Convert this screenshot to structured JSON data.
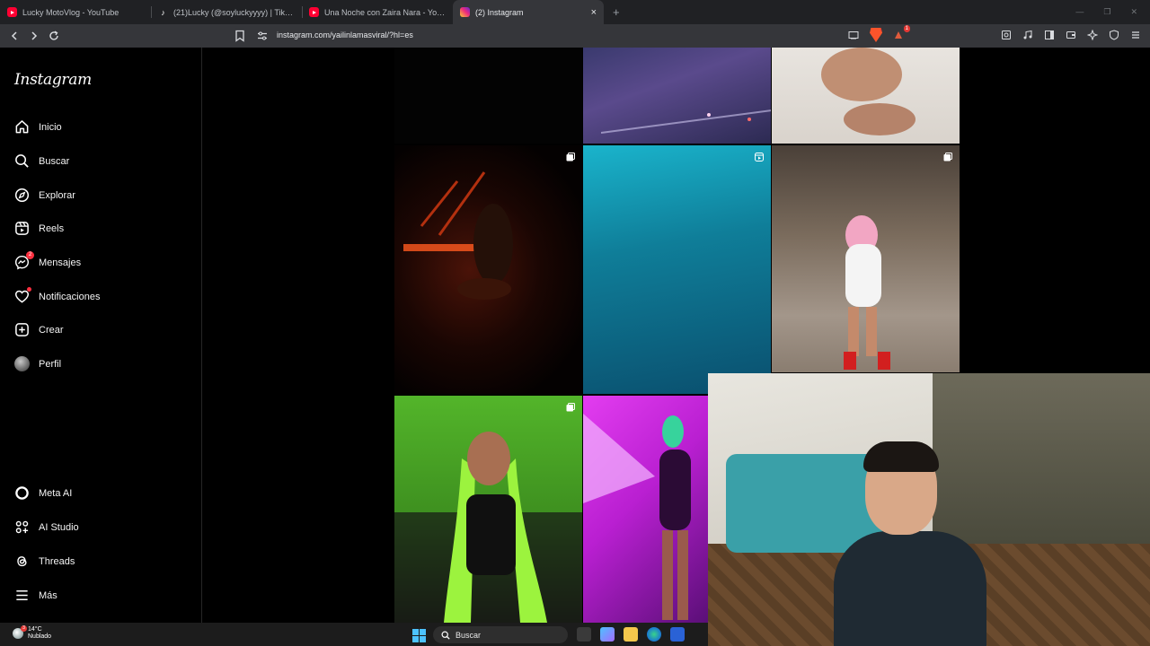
{
  "browser": {
    "tabs": [
      {
        "title": "Lucky MotoVlog - YouTube",
        "icon": "youtube-icon",
        "active": false
      },
      {
        "title": "(21)Lucky (@soyluckyyyy) | TikTok",
        "icon": "tiktok-icon",
        "active": false
      },
      {
        "title": "Una Noche con Zaira Nara - YouTube",
        "icon": "youtube-icon",
        "active": false
      },
      {
        "title": "(2) Instagram",
        "icon": "instagram-icon",
        "active": true
      }
    ],
    "new_tab_symbol": "+",
    "close_symbol": "×",
    "window_controls": [
      "—",
      "❐",
      "✕"
    ],
    "url_host": "instagram.com",
    "url_path": "/yailinlamasviral/?hl=es",
    "brave_badge": "5",
    "rewards_badge": "1"
  },
  "sidebar": {
    "logo": "Instagram",
    "items": [
      {
        "label": "Inicio",
        "icon": "home-icon"
      },
      {
        "label": "Buscar",
        "icon": "search-icon"
      },
      {
        "label": "Explorar",
        "icon": "compass-icon"
      },
      {
        "label": "Reels",
        "icon": "reels-icon"
      },
      {
        "label": "Mensajes",
        "icon": "messenger-icon",
        "badge": "2"
      },
      {
        "label": "Notificaciones",
        "icon": "heart-icon"
      },
      {
        "label": "Crear",
        "icon": "plus-square-icon"
      },
      {
        "label": "Perfil",
        "icon": "avatar"
      }
    ],
    "bottom_items": [
      {
        "label": "Meta AI",
        "icon": "meta-ai-icon"
      },
      {
        "label": "AI Studio",
        "icon": "ai-studio-icon"
      },
      {
        "label": "Threads",
        "icon": "threads-icon"
      },
      {
        "label": "Más",
        "icon": "menu-icon"
      }
    ]
  },
  "posts": [
    {
      "type": "image"
    },
    {
      "type": "image"
    },
    {
      "type": "image"
    },
    {
      "type": "carousel"
    },
    {
      "type": "reel"
    },
    {
      "type": "carousel"
    },
    {
      "type": "carousel"
    },
    {
      "type": "image"
    }
  ],
  "taskbar": {
    "weather_temp": "14°C",
    "weather_desc": "Nublado",
    "weather_badge": "3",
    "search_label": "Buscar"
  },
  "colors": {
    "notification": "#ff3040",
    "ig_background": "#000000",
    "browser_chrome": "#35363a"
  }
}
